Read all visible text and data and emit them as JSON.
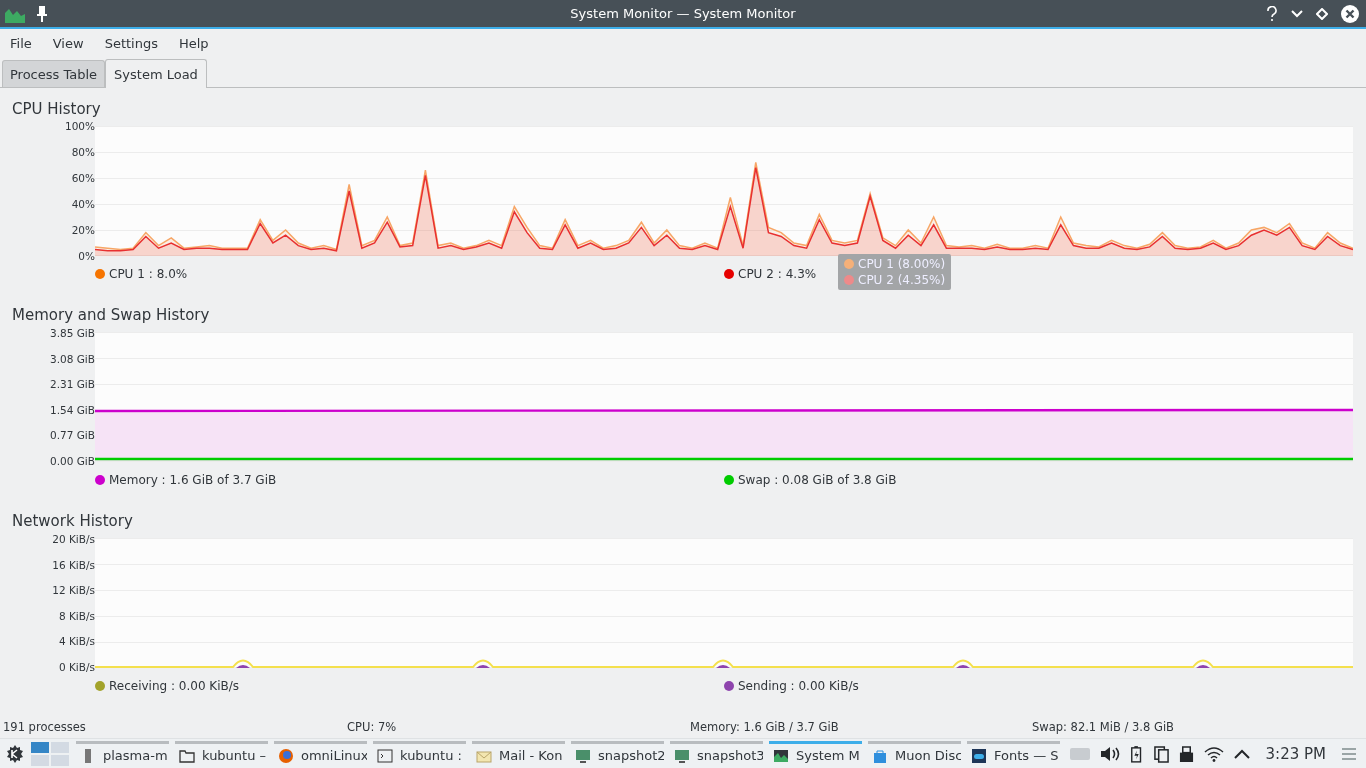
{
  "window": {
    "title": "System Monitor — System Monitor"
  },
  "menu": [
    "File",
    "View",
    "Settings",
    "Help"
  ],
  "tabs": [
    {
      "label": "Process Table",
      "selected": false
    },
    {
      "label": "System Load",
      "selected": true
    }
  ],
  "sections": [
    {
      "kind": "cpu",
      "title": "CPU History",
      "chart_data": {
        "type": "area",
        "grid": true,
        "ylim": [
          0,
          100
        ],
        "yticks": [
          {
            "value": 100,
            "label": "100%"
          },
          {
            "value": 80,
            "label": "80%"
          },
          {
            "value": 60,
            "label": "60%"
          },
          {
            "value": 40,
            "label": "40%"
          },
          {
            "value": 20,
            "label": "20%"
          },
          {
            "value": 0,
            "label": "0%"
          }
        ],
        "series": [
          {
            "name": "CPU 1",
            "color": "#f7a666",
            "values": [
              7,
              6,
              5,
              6,
              18,
              8,
              14,
              6,
              7,
              8,
              6,
              6,
              6,
              28,
              12,
              20,
              10,
              6,
              8,
              5,
              55,
              8,
              12,
              30,
              8,
              10,
              66,
              8,
              10,
              6,
              8,
              12,
              8,
              38,
              22,
              8,
              6,
              28,
              8,
              12,
              6,
              8,
              12,
              26,
              10,
              20,
              8,
              6,
              10,
              6,
              45,
              8,
              72,
              22,
              18,
              10,
              8,
              32,
              12,
              10,
              12,
              48,
              14,
              8,
              20,
              10,
              30,
              8,
              7,
              8,
              6,
              9,
              6,
              6,
              8,
              6,
              30,
              10,
              8,
              7,
              12,
              8,
              6,
              9,
              18,
              8,
              6,
              7,
              12,
              6,
              10,
              20,
              22,
              18,
              25,
              10,
              6,
              18,
              10,
              6
            ]
          },
          {
            "name": "CPU 2",
            "color": "#e83030",
            "values": [
              5,
              4,
              4,
              5,
              15,
              6,
              10,
              5,
              6,
              6,
              5,
              5,
              5,
              25,
              10,
              16,
              8,
              5,
              6,
              4,
              50,
              6,
              10,
              26,
              7,
              8,
              62,
              6,
              8,
              5,
              7,
              10,
              6,
              34,
              18,
              6,
              5,
              24,
              6,
              10,
              5,
              6,
              10,
              22,
              8,
              16,
              6,
              5,
              8,
              5,
              38,
              6,
              68,
              18,
              15,
              8,
              6,
              28,
              10,
              8,
              10,
              46,
              12,
              6,
              16,
              8,
              24,
              6,
              6,
              6,
              5,
              7,
              5,
              5,
              6,
              5,
              24,
              8,
              6,
              6,
              10,
              6,
              5,
              7,
              15,
              6,
              5,
              6,
              10,
              5,
              8,
              16,
              20,
              16,
              22,
              8,
              5,
              15,
              8,
              5
            ]
          }
        ]
      },
      "legend": [
        {
          "reading": ": 8.0%",
          "color": "#f67400"
        },
        {
          "reading": ": 4.3%",
          "color": "#e60000"
        }
      ],
      "tooltip": [
        {
          "label": "CPU 1 (8.00%)",
          "color": "#f5b079"
        },
        {
          "label": "CPU 2 (4.35%)",
          "color": "#ee8a8a"
        }
      ]
    },
    {
      "kind": "memory",
      "title": "Memory and Swap History",
      "yticks": [
        "3.85 GiB",
        "3.08 GiB",
        "2.31 GiB",
        "1.54 GiB",
        "0.77 GiB",
        "0.00 GiB"
      ],
      "legend": [
        {
          "label": "Memory : 1.6 GiB of 3.7 GiB",
          "color": "#cc00cc"
        },
        {
          "label": "Swap : 0.08 GiB of 3.8 GiB",
          "color": "#00cc00"
        }
      ]
    },
    {
      "kind": "network",
      "title": "Network History",
      "yticks": [
        "20 KiB/s",
        "16 KiB/s",
        "12 KiB/s",
        "8 KiB/s",
        "4 KiB/s",
        "0 KiB/s"
      ],
      "legend": [
        {
          "label": "Receiving : 0.00 KiB/s",
          "color": "#a3a32b"
        },
        {
          "label": "Sending : 0.00 KiB/s",
          "color": "#8e44ad"
        }
      ]
    }
  ],
  "status_bar": [
    "191 processes",
    "CPU: 7%",
    "Memory: 1.6 GiB / 3.7 GiB",
    "Swap: 82.1 MiB / 3.8 GiB"
  ],
  "taskbar": {
    "tasks": [
      {
        "kind": "generic",
        "label": "plasma-m",
        "selected": false
      },
      {
        "kind": "folder",
        "label": "kubuntu –",
        "selected": false
      },
      {
        "kind": "browser",
        "label": "omniLinux",
        "selected": false
      },
      {
        "kind": "terminal",
        "label": "kubuntu :",
        "selected": false
      },
      {
        "kind": "mail",
        "label": "Mail - Kon",
        "selected": false
      },
      {
        "kind": "image",
        "label": "snapshot2",
        "selected": false
      },
      {
        "kind": "image",
        "label": "snapshot3",
        "selected": false
      },
      {
        "kind": "monitor",
        "label": "System M",
        "selected": true
      },
      {
        "kind": "bag",
        "label": "Muon Disc",
        "selected": false
      },
      {
        "kind": "toggle",
        "label": "Fonts — S",
        "selected": false
      }
    ],
    "clock": "3:23 PM"
  }
}
